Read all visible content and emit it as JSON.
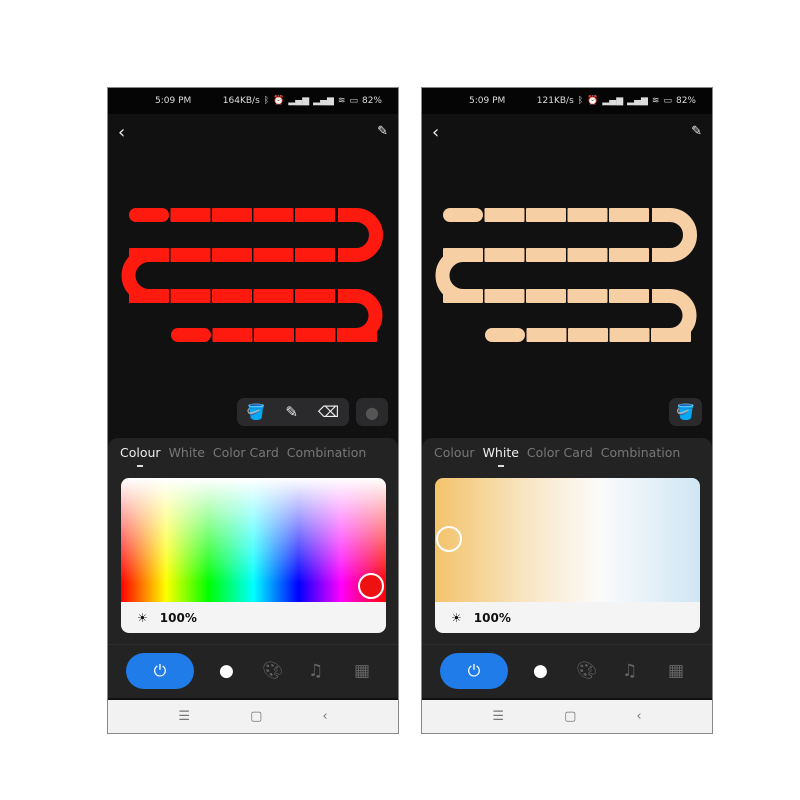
{
  "phones": [
    {
      "status": {
        "time": "5:09 PM",
        "speed": "164KB/s",
        "battery": "82%"
      },
      "strip_color": "#ff1a10",
      "tabs": [
        "Colour",
        "White",
        "Color Card",
        "Combination"
      ],
      "active_tab": 0,
      "picker": "colour",
      "thumb_color": "#ee1111",
      "brightness": "100%",
      "tools": [
        "paint-bucket-icon",
        "brush-icon",
        "eraser-icon",
        "record-icon"
      ]
    },
    {
      "status": {
        "time": "5:09 PM",
        "speed": "121KB/s",
        "battery": "82%"
      },
      "strip_color": "#f6cfa4",
      "tabs": [
        "Colour",
        "White",
        "Color Card",
        "Combination"
      ],
      "active_tab": 1,
      "picker": "white",
      "thumb_color": "transparent",
      "brightness": "100%",
      "tools": [
        "paint-bucket-icon"
      ]
    }
  ],
  "accent": "#1f7ce8"
}
